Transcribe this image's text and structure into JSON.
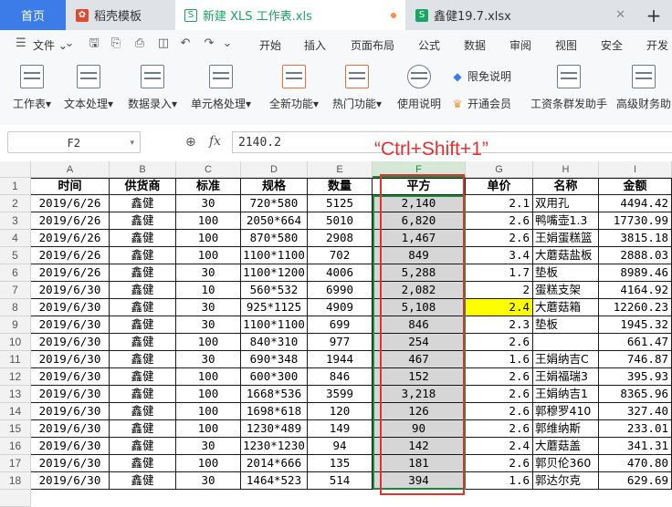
{
  "tabs": [
    {
      "label": "首页",
      "type": "home"
    },
    {
      "label": "稻壳模板",
      "type": "plain",
      "icon": "daoke-icon"
    },
    {
      "label": "新建 XLS 工作表.xls",
      "type": "active",
      "icon": "sheet-icon",
      "modified": true
    },
    {
      "label": "鑫健19.7.xlsx",
      "type": "plain",
      "icon": "sheet-icon"
    }
  ],
  "menubar": {
    "file_label": "文件",
    "items": [
      "开始",
      "插入",
      "页面布局",
      "公式",
      "数据",
      "审阅",
      "视图",
      "安全",
      "开发"
    ]
  },
  "ribbon": {
    "buttons": [
      "工作表",
      "文本处理",
      "数据录入",
      "单元格处理",
      "全新功能",
      "热门功能",
      "使用说明",
      "工资条群发助手",
      "高级财务助"
    ],
    "limited_free": "限免说明",
    "vip": "开通会员"
  },
  "formula_bar": {
    "name_box": "F2",
    "fx": "fx",
    "value": "2140.2"
  },
  "annotation": "“Ctrl+Shift+1”",
  "columns": [
    "A",
    "B",
    "C",
    "D",
    "E",
    "F",
    "G",
    "H",
    "I"
  ],
  "headers": [
    "时间",
    "供货商",
    "标准",
    "规格",
    "数量",
    "平方",
    "单价",
    "名称",
    "金额"
  ],
  "rows": [
    [
      "2019/6/26",
      "鑫健",
      "30",
      "720*580",
      "5125",
      "2,140",
      "2.1",
      "双用孔",
      "4494.42"
    ],
    [
      "2019/6/26",
      "鑫健",
      "100",
      "2050*664",
      "5010",
      "6,820",
      "2.6",
      "鸭嘴壶1.3",
      "17730.99"
    ],
    [
      "2019/6/26",
      "鑫健",
      "100",
      "870*580",
      "2908",
      "1,467",
      "2.6",
      "王娟蛋糕篮",
      "3815.18"
    ],
    [
      "2019/6/26",
      "鑫健",
      "100",
      "1100*1100",
      "702",
      "849",
      "3.4",
      "大蘑菇盐板",
      "2888.03"
    ],
    [
      "2019/6/26",
      "鑫健",
      "30",
      "1100*1200",
      "4006",
      "5,288",
      "1.7",
      "垫板",
      "8989.46"
    ],
    [
      "2019/6/30",
      "鑫健",
      "10",
      "560*532",
      "6990",
      "2,082",
      "2",
      "蛋糕支架",
      "4164.92"
    ],
    [
      "2019/6/30",
      "鑫健",
      "30",
      "925*1125",
      "4909",
      "5,108",
      "2.4",
      "大蘑菇箱",
      "12260.23"
    ],
    [
      "2019/6/30",
      "鑫健",
      "30",
      "1100*1100",
      "699",
      "846",
      "2.3",
      "垫板",
      "1945.32"
    ],
    [
      "2019/6/30",
      "鑫健",
      "100",
      "840*310",
      "977",
      "254",
      "2.6",
      "",
      "661.47"
    ],
    [
      "2019/6/30",
      "鑫健",
      "30",
      "690*348",
      "1944",
      "467",
      "1.6",
      "王娟纳吉C",
      "746.87"
    ],
    [
      "2019/6/30",
      "鑫健",
      "100",
      "600*300",
      "846",
      "152",
      "2.6",
      "王娟福瑞3",
      "395.93"
    ],
    [
      "2019/6/30",
      "鑫健",
      "100",
      "1668*536",
      "3599",
      "3,218",
      "2.6",
      "王娟纳吉1",
      "8365.96"
    ],
    [
      "2019/6/30",
      "鑫健",
      "100",
      "1698*618",
      "120",
      "126",
      "2.6",
      "郭穆罗410",
      "327.40"
    ],
    [
      "2019/6/30",
      "鑫健",
      "100",
      "1230*489",
      "149",
      "90",
      "2.6",
      "郭维纳斯",
      "233.01"
    ],
    [
      "2019/6/30",
      "鑫健",
      "30",
      "1230*1230",
      "94",
      "142",
      "2.4",
      "大蘑菇盖",
      "341.31"
    ],
    [
      "2019/6/30",
      "鑫健",
      "100",
      "2014*666",
      "135",
      "181",
      "2.6",
      "郭贝伦360",
      "470.80"
    ],
    [
      "2019/6/30",
      "鑫健",
      "30",
      "1464*523",
      "514",
      "394",
      "1.6",
      "郭达尔克",
      "629.69"
    ]
  ],
  "row_numbers": [
    "1",
    "2",
    "3",
    "4",
    "5",
    "6",
    "7",
    "8",
    "9",
    "10",
    "11",
    "12",
    "13",
    "14",
    "15",
    "16",
    "17",
    "18"
  ],
  "highlight": {
    "row": 6,
    "col": 6,
    "color": "#ffff00"
  },
  "colors": {
    "accent": "#3b7ce9",
    "green": "#1aa563",
    "annotation": "#e53030",
    "selection": "#1d8a3a"
  }
}
